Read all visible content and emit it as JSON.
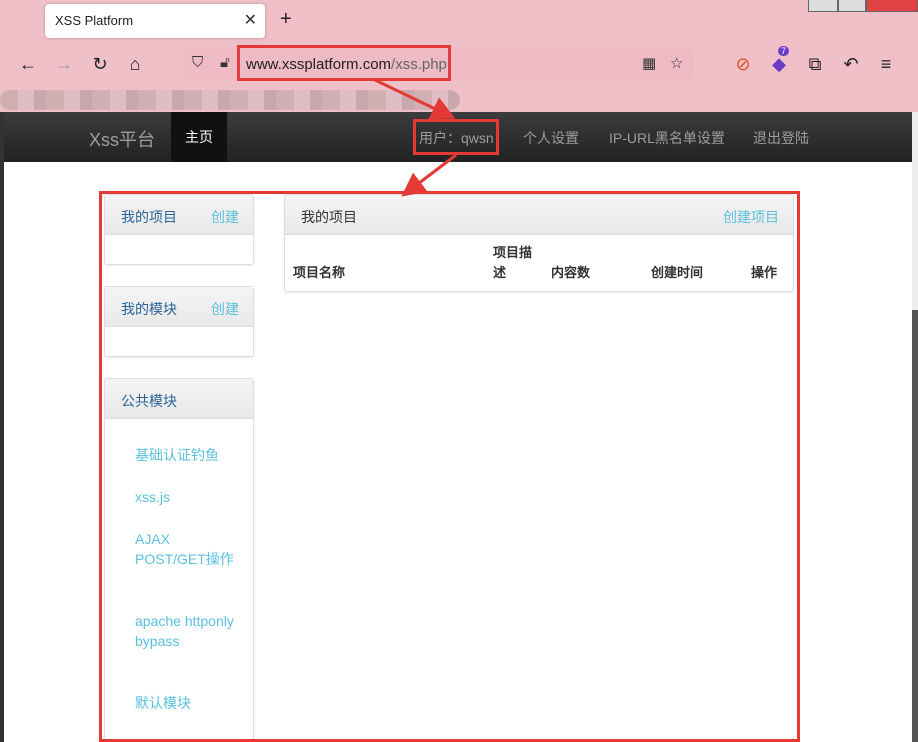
{
  "browser": {
    "tab_title": "XSS Platform",
    "tab_close": "✕",
    "new_tab": "+",
    "url_host": "www.xssplatform.com",
    "url_path": "/xss.php",
    "ext_badge": "7",
    "icons": [
      "back-arrow-icon",
      "forward-arrow-icon",
      "reload-icon",
      "home-icon",
      "shield-icon",
      "lock-icon",
      "qr-code-icon",
      "star-icon",
      "extension-icon",
      "puzzle-icon",
      "undo-icon",
      "menu-icon"
    ]
  },
  "site": {
    "brand": "Xss平台",
    "home": "主页",
    "user": "用户：qwsn",
    "settings": "个人设置",
    "blacklist": "IP-URL黑名单设置",
    "logout": "退出登陆"
  },
  "sidebar": {
    "my_projects": {
      "title": "我的项目",
      "action": "创建"
    },
    "my_modules": {
      "title": "我的模块",
      "action": "创建"
    },
    "public_modules": {
      "title": "公共模块",
      "items": [
        "基础认证钓鱼",
        "xss.js",
        "AJAX POST/GET操作",
        "apache httponly bypass",
        "默认模块"
      ]
    }
  },
  "main": {
    "title": "我的项目",
    "action": "创建项目",
    "columns": [
      "项目名称",
      "项目描述",
      "内容数",
      "创建时间",
      "操作"
    ]
  },
  "colors": {
    "accent_link": "#5bc0de",
    "annotation": "#e53935",
    "chrome": "#f0c0c8"
  }
}
